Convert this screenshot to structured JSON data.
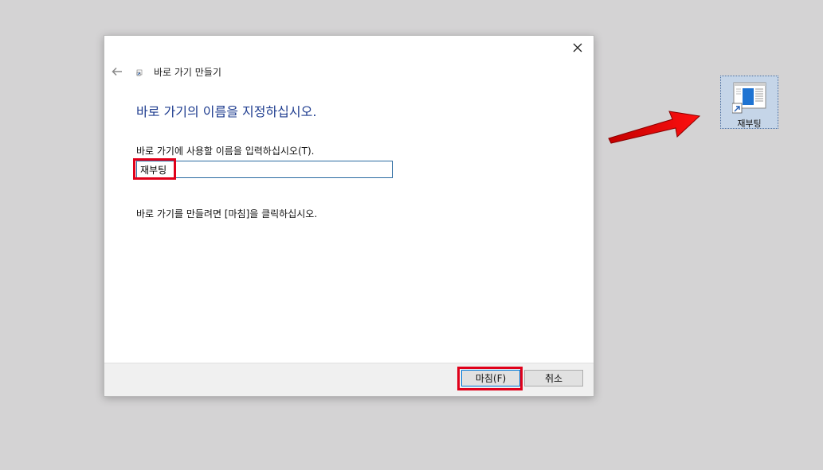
{
  "dialog": {
    "window_title": "바로 가기 만들기",
    "heading": "바로 가기의 이름을 지정하십시오.",
    "name_label": "바로 가기에 사용할 이름을 입력하십시오(T).",
    "name_value": "재부팅",
    "hint": "바로 가기를 만들려면 [마침]을 클릭하십시오.",
    "finish_label": "마침(F)",
    "cancel_label": "취소"
  },
  "desktop": {
    "shortcut_label": "재부팅"
  },
  "colors": {
    "heading": "#1e3c8f",
    "highlight": "#e0001a",
    "desktop_bg": "#d4d3d4",
    "input_border": "#2b6ba1"
  },
  "icons": [
    "close-icon",
    "back-arrow-icon",
    "shortcut-icon",
    "red-arrow-icon"
  ]
}
